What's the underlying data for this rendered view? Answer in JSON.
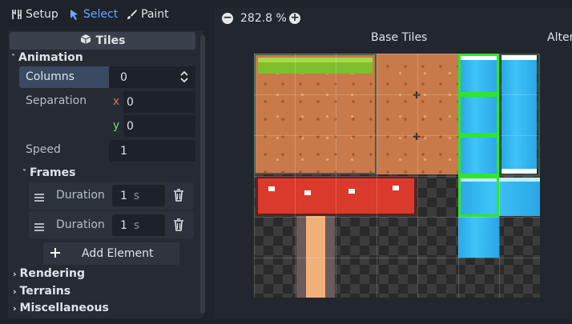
{
  "toolbar": {
    "setup_label": "Setup",
    "select_label": "Select",
    "paint_label": "Paint"
  },
  "inspector": {
    "header_title": "Tiles",
    "animation_label": "Animation",
    "columns_label": "Columns",
    "columns_value": "0",
    "separation_label": "Separation",
    "sep_x_label": "x",
    "sep_x_value": "0",
    "sep_y_label": "y",
    "sep_y_value": "0",
    "speed_label": "Speed",
    "speed_value": "1",
    "frames_label": "Frames",
    "frames": [
      {
        "label": "Duration",
        "value": "1",
        "unit": "s"
      },
      {
        "label": "Duration",
        "value": "1",
        "unit": "s"
      }
    ],
    "add_element_label": "Add Element",
    "rendering_label": "Rendering",
    "terrains_label": "Terrains",
    "misc_label": "Miscellaneous"
  },
  "viewport": {
    "zoom_value": "282.8 %",
    "base_tiles_label": "Base Tiles",
    "alternative_label": "Alter"
  },
  "colors": {
    "accent": "#6ea6ff",
    "selection": "#2ee62e",
    "panel": "#262b33"
  }
}
